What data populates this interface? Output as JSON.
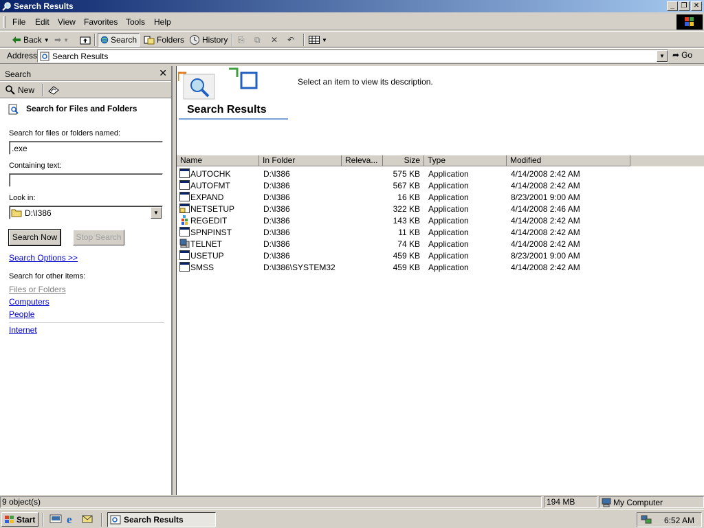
{
  "window": {
    "title": "Search Results"
  },
  "menu": [
    "File",
    "Edit",
    "View",
    "Favorites",
    "Tools",
    "Help"
  ],
  "toolbar": {
    "back": "Back",
    "search": "Search",
    "folders": "Folders",
    "history": "History"
  },
  "address": {
    "label": "Address",
    "value": "Search Results",
    "go": "Go"
  },
  "search_pane": {
    "header": "Search",
    "new_label": "New",
    "heading": "Search for Files and Folders",
    "named_label": "Search for files or folders named:",
    "named_value": ".exe",
    "containing_label": "Containing text:",
    "containing_value": "",
    "look_in_label": "Look in:",
    "look_in_value": "D:\\I386",
    "search_now": "Search Now",
    "stop_search": "Stop Search",
    "options_link": "Search Options >>",
    "other_items_label": "Search for other items:",
    "other_links": [
      "Files or Folders",
      "Computers",
      "People"
    ],
    "internet_link": "Internet"
  },
  "results_pane": {
    "title": "Search Results",
    "description": "Select an item to view its description.",
    "columns": [
      "Name",
      "In Folder",
      "Releva...",
      "Size",
      "Type",
      "Modified"
    ],
    "rows": [
      {
        "name": "AUTOCHK",
        "folder": "D:\\I386",
        "size": "575 KB",
        "type": "Application",
        "modified": "4/14/2008 2:42 AM",
        "icon": "app-window-icon"
      },
      {
        "name": "AUTOFMT",
        "folder": "D:\\I386",
        "size": "567 KB",
        "type": "Application",
        "modified": "4/14/2008 2:42 AM",
        "icon": "app-window-icon"
      },
      {
        "name": "EXPAND",
        "folder": "D:\\I386",
        "size": "16 KB",
        "type": "Application",
        "modified": "8/23/2001 9:00 AM",
        "icon": "app-window-icon"
      },
      {
        "name": "NETSETUP",
        "folder": "D:\\I386",
        "size": "322 KB",
        "type": "Application",
        "modified": "4/14/2008 2:46 AM",
        "icon": "netsetup-icon"
      },
      {
        "name": "REGEDIT",
        "folder": "D:\\I386",
        "size": "143 KB",
        "type": "Application",
        "modified": "4/14/2008 2:42 AM",
        "icon": "regedit-icon"
      },
      {
        "name": "SPNPINST",
        "folder": "D:\\I386",
        "size": "11 KB",
        "type": "Application",
        "modified": "4/14/2008 2:42 AM",
        "icon": "app-window-icon"
      },
      {
        "name": "TELNET",
        "folder": "D:\\I386",
        "size": "74 KB",
        "type": "Application",
        "modified": "4/14/2008 2:42 AM",
        "icon": "telnet-icon"
      },
      {
        "name": "USETUP",
        "folder": "D:\\I386",
        "size": "459 KB",
        "type": "Application",
        "modified": "8/23/2001 9:00 AM",
        "icon": "app-window-icon"
      },
      {
        "name": "SMSS",
        "folder": "D:\\I386\\SYSTEM32",
        "size": "459 KB",
        "type": "Application",
        "modified": "4/14/2008 2:42 AM",
        "icon": "app-window-icon"
      }
    ]
  },
  "status": {
    "objects": "9 object(s)",
    "size": "194 MB",
    "location": "My Computer"
  },
  "taskbar": {
    "start": "Start",
    "task": "Search Results",
    "clock": "6:52 AM"
  },
  "colors": {
    "title_start": "#0a246a",
    "title_end": "#a6caf0",
    "link": "#0000cc",
    "face": "#d4d0c8"
  }
}
